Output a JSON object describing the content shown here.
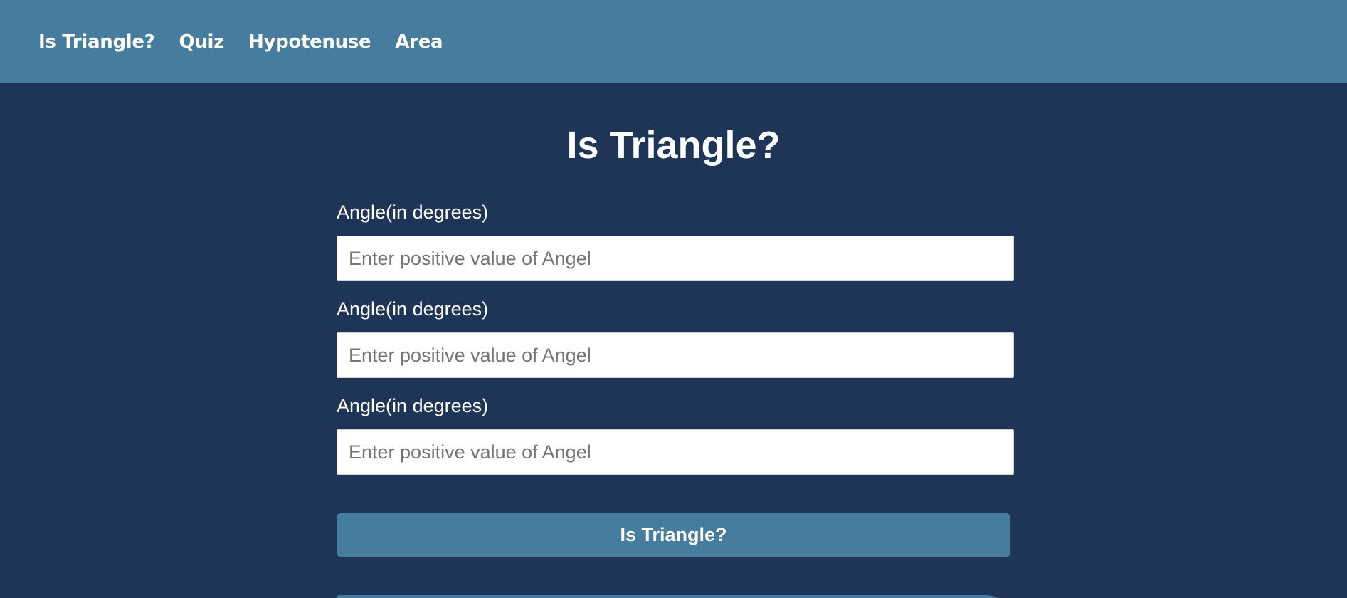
{
  "nav": {
    "items": [
      {
        "label": "Is Triangle?"
      },
      {
        "label": "Quiz"
      },
      {
        "label": "Hypotenuse"
      },
      {
        "label": "Area"
      }
    ]
  },
  "main": {
    "title": "Is Triangle?",
    "fields": [
      {
        "label": "Angle(in degrees)",
        "placeholder": "Enter positive value of Angel",
        "value": ""
      },
      {
        "label": "Angle(in degrees)",
        "placeholder": "Enter positive value of Angel",
        "value": ""
      },
      {
        "label": "Angle(in degrees)",
        "placeholder": "Enter positive value of Angel",
        "value": ""
      }
    ],
    "submit_label": "Is Triangle?"
  },
  "colors": {
    "navbar": "#467c9e",
    "background": "#1e3558",
    "button": "#467c9e",
    "text": "#ffffff"
  }
}
